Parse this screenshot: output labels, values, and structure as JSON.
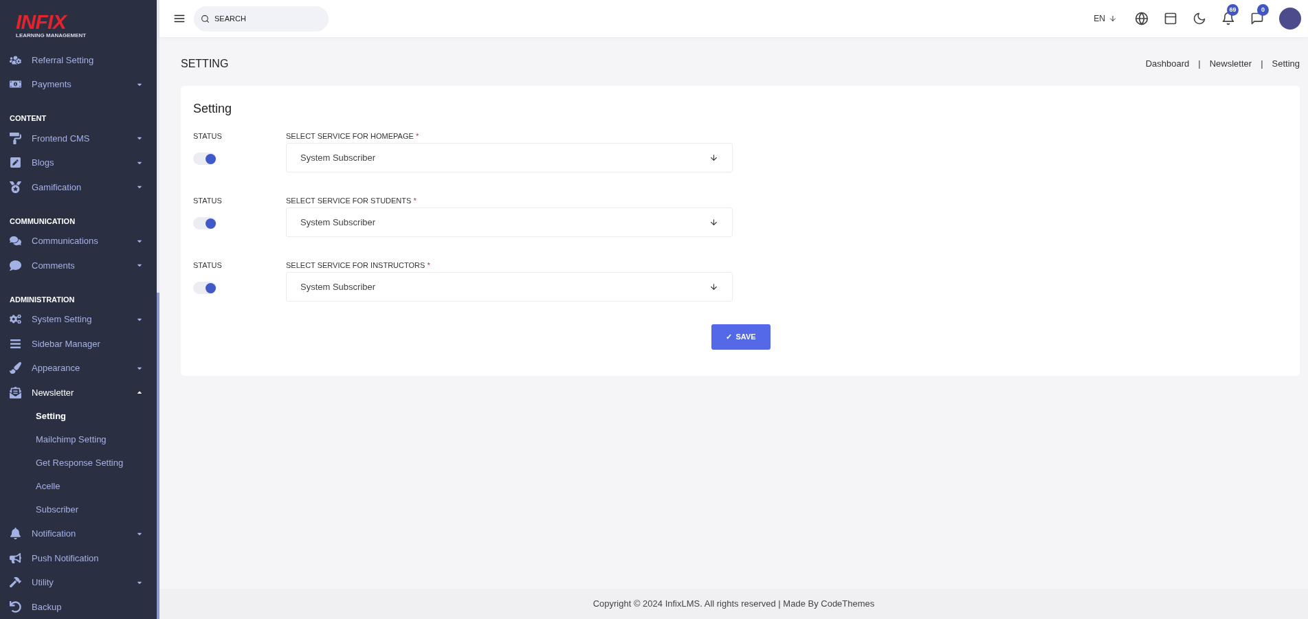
{
  "logo": {
    "mark": "INFIX",
    "tagline": "LEARNING MANAGEMENT"
  },
  "sidebar": {
    "sections": [
      {
        "items": [
          {
            "kind": "link",
            "label": "Referral Setting"
          },
          {
            "kind": "group",
            "label": "Payments",
            "expanded": false
          }
        ]
      },
      {
        "title": "CONTENT",
        "items": [
          {
            "kind": "group",
            "label": "Frontend CMS",
            "expanded": false
          },
          {
            "kind": "group",
            "label": "Blogs",
            "expanded": false
          },
          {
            "kind": "group",
            "label": "Gamification",
            "expanded": false
          }
        ]
      },
      {
        "title": "COMMUNICATION",
        "items": [
          {
            "kind": "group",
            "label": "Communications",
            "expanded": false
          },
          {
            "kind": "group",
            "label": "Comments",
            "expanded": false
          }
        ]
      },
      {
        "title": "ADMINISTRATION",
        "items": [
          {
            "kind": "group",
            "label": "System Setting",
            "expanded": false
          },
          {
            "kind": "link",
            "label": "Sidebar Manager"
          },
          {
            "kind": "group",
            "label": "Appearance",
            "expanded": false
          },
          {
            "kind": "group",
            "label": "Newsletter",
            "expanded": true,
            "children": [
              {
                "label": "Setting",
                "selected": true
              },
              {
                "label": "Mailchimp Setting",
                "selected": false
              },
              {
                "label": "Get Response Setting",
                "selected": false
              },
              {
                "label": "Acelle",
                "selected": false
              },
              {
                "label": "Subscriber",
                "selected": false
              }
            ]
          },
          {
            "kind": "group",
            "label": "Notification",
            "expanded": false
          },
          {
            "kind": "link",
            "label": "Push Notification"
          },
          {
            "kind": "group",
            "label": "Utility",
            "expanded": false
          },
          {
            "kind": "link",
            "label": "Backup"
          }
        ]
      }
    ]
  },
  "header": {
    "search": {
      "placeholder": "SEARCH"
    },
    "language": "EN",
    "notifications_badge": "69",
    "messages_badge": "0"
  },
  "page": {
    "title": "SETTING",
    "breadcrumb": [
      "Dashboard",
      "Newsletter",
      "Setting"
    ],
    "separator": "|"
  },
  "card": {
    "title": "Setting",
    "rows": [
      {
        "status_label": "STATUS",
        "on": true,
        "select_label": "SELECT SERVICE FOR HOMEPAGE",
        "required": "*",
        "value": "System Subscriber"
      },
      {
        "status_label": "STATUS",
        "on": true,
        "select_label": "SELECT SERVICE FOR STUDENTS",
        "required": "*",
        "value": "System Subscriber"
      },
      {
        "status_label": "STATUS",
        "on": true,
        "select_label": "SELECT SERVICE FOR INSTRUCTORS",
        "required": "*",
        "value": "System Subscriber"
      }
    ],
    "save_button": {
      "icon": "✓",
      "label": "SAVE"
    }
  },
  "footer": "Copyright © 2024 InfixLMS. All rights reserved | Made By CodeThemes"
}
